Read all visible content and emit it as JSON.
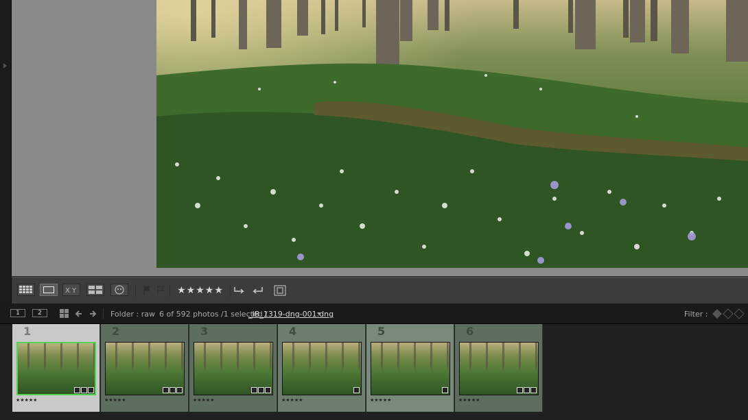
{
  "toolbar": {
    "rating_stars": "★★★★★"
  },
  "filmstrip_bar": {
    "monitor_1": "1",
    "monitor_2": "2",
    "folder": "Folder : raw",
    "count": "6 of 592 photos /1 selected /",
    "filename": "_IB_1319-dng-001.dng",
    "filter_label": "Filter :"
  },
  "filmstrip": {
    "cells": [
      {
        "number": "1",
        "stars": "★★★★★"
      },
      {
        "number": "2",
        "stars": "★★★★★"
      },
      {
        "number": "3",
        "stars": "★★★★★"
      },
      {
        "number": "4",
        "stars": "★★★★★"
      },
      {
        "number": "5",
        "stars": "★★★★★"
      },
      {
        "number": "6",
        "stars": "★★★★★"
      }
    ]
  },
  "colors": {
    "selection_border": "#52d452",
    "cell_background_selected": "#c9c9c9",
    "cell_background": "#5e6e5e"
  }
}
